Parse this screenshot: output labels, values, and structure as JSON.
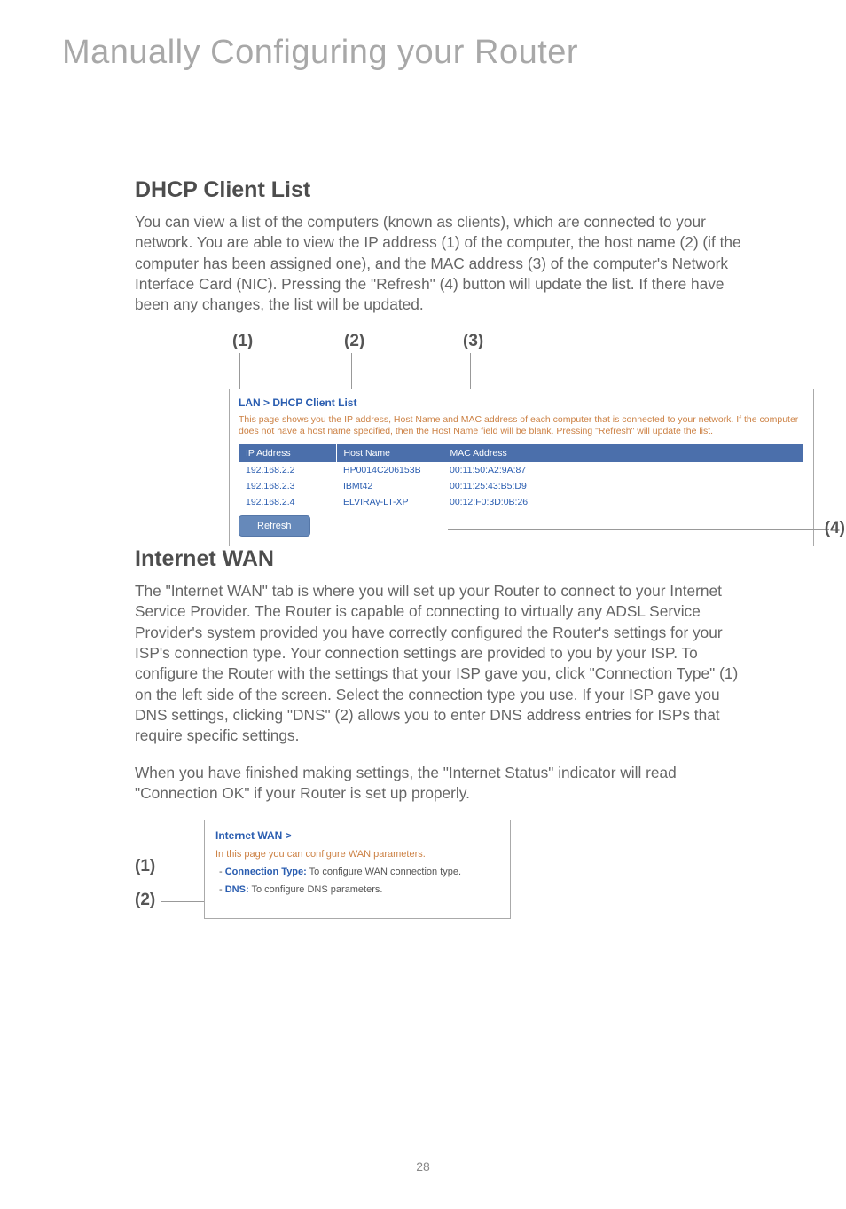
{
  "header": {
    "title": "Manually Configuring your Router"
  },
  "dhcp": {
    "section_title": "DHCP Client List",
    "body": "You can view a list of the computers (known as clients), which are connected to your network. You are able to view the IP address (1) of the computer, the host name (2) (if the computer has been assigned one), and the MAC address (3) of the computer's Network Interface Card (NIC). Pressing the \"Refresh\" (4) button will update the list. If there have been any changes, the list will be updated.",
    "markers": {
      "m1": "(1)",
      "m2": "(2)",
      "m3": "(3)",
      "m4": "(4)"
    },
    "panel": {
      "title_prefix": "LAN > ",
      "title_main": "DHCP Client List",
      "description": "This page shows you the IP address, Host Name and MAC address of each computer that is connected to your network. If the computer does not have a host name specified, then the Host Name field will be blank. Pressing \"Refresh\" will update the list.",
      "columns": {
        "ip": "IP Address",
        "host": "Host Name",
        "mac": "MAC Address"
      },
      "rows": [
        {
          "ip": "192.168.2.2",
          "host": "HP0014C206153B",
          "mac": "00:11:50:A2:9A:87"
        },
        {
          "ip": "192.168.2.3",
          "host": "IBMt42",
          "mac": "00:11:25:43:B5:D9"
        },
        {
          "ip": "192.168.2.4",
          "host": "ELVIRAy-LT-XP",
          "mac": "00:12:F0:3D:0B:26"
        }
      ],
      "refresh": "Refresh"
    }
  },
  "wan": {
    "section_title": "Internet WAN",
    "body1": "The \"Internet WAN\" tab is where you will set up your Router to connect to your Internet Service Provider. The Router is capable of connecting to virtually any ADSL Service Provider's system provided you have correctly configured the Router's settings for your ISP's connection type. Your connection settings are provided to you by your ISP. To configure the Router with the settings that your ISP gave you, click \"Connection Type\" (1) on the left side of the screen. Select the connection type you use. If your ISP gave you DNS settings, clicking \"DNS\" (2) allows you to enter DNS address entries for ISPs that require specific settings.",
    "body2": "When you have finished making settings, the \"Internet Status\" indicator will read \"Connection OK\" if your Router is set up properly.",
    "markers": {
      "m1": "(1)",
      "m2": "(2)"
    },
    "panel": {
      "title": "Internet WAN >",
      "desc": "In this page you can configure WAN parameters.",
      "line1_link": "Connection Type:",
      "line1_rest": " To configure WAN connection type.",
      "line2_link": "DNS:",
      "line2_rest": " To configure DNS parameters."
    }
  },
  "page_number": "28"
}
